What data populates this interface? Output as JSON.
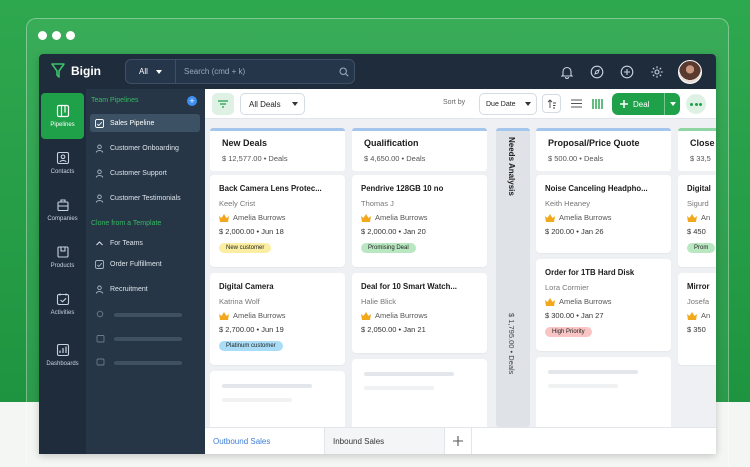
{
  "app": {
    "name": "Bigin"
  },
  "search": {
    "scope": "All",
    "placeholder": "Search (cmd + k)"
  },
  "topbar": {
    "icons": [
      "bell-icon",
      "compass-icon",
      "plus-circle-icon",
      "gear-icon",
      "user-avatar"
    ]
  },
  "leftnav": [
    {
      "label": "Pipelines",
      "icon": "pipelines-icon",
      "active": true
    },
    {
      "label": "Contacts",
      "icon": "contacts-icon"
    },
    {
      "label": "Companies",
      "icon": "companies-icon"
    },
    {
      "label": "Products",
      "icon": "products-icon"
    },
    {
      "label": "Activities",
      "icon": "activities-icon"
    },
    {
      "label": "Dashboards",
      "icon": "dashboards-icon"
    }
  ],
  "sidebar": {
    "team_heading": "Team Pipelines",
    "items": [
      {
        "label": "Sales Pipeline",
        "active": true
      },
      {
        "label": "Customer Onboarding"
      },
      {
        "label": "Customer Support"
      },
      {
        "label": "Customer Testimonials"
      }
    ],
    "template_heading": "Clone from a Template",
    "template_group": "For Teams",
    "templates": [
      {
        "label": "Order Fulfillment"
      },
      {
        "label": "Recruitment"
      }
    ]
  },
  "toolbar": {
    "view": "All Deals",
    "sort_by_label": "Sort by",
    "sort_field": "Due Date",
    "new_deal": "Deal"
  },
  "columns": [
    {
      "title": "New Deals",
      "summary": "$ 12,577.00 • Deals"
    },
    {
      "title": "Qualification",
      "summary": "$ 4,650.00 • Deals"
    },
    {
      "title": "Proposal/Price Quote",
      "summary": "$ 500.00 • Deals"
    },
    {
      "title": "Close",
      "summary": "$ 33,5"
    }
  ],
  "collapsed_column": {
    "title": "Needs Analysis",
    "summary": "$ 1,795.00 • Deals"
  },
  "cards": {
    "new_deals": [
      {
        "title": "Back Camera Lens Protec...",
        "contact": "Keely Crist",
        "owner": "Amelia Burrows",
        "amount": "$ 2,000.00 • Jun 18",
        "tag": "New customer",
        "tag_color": "#fbeea2"
      },
      {
        "title": "Digital Camera",
        "contact": "Katrina Wolf",
        "owner": "Amelia Burrows",
        "amount": "$ 2,700.00 • Jun 19",
        "tag": "Platinum customer",
        "tag_color": "#a9dcf7"
      }
    ],
    "qualification": [
      {
        "title": "Pendrive 128GB 10 no",
        "contact": "Thomas J",
        "owner": "Amelia Burrows",
        "amount": "$ 2,000.00 • Jan 20",
        "tag": "Promising Deal",
        "tag_color": "#b9e7c1"
      },
      {
        "title": "Deal for 10 Smart Watch...",
        "contact": "Halie Blick",
        "owner": "Amelia Burrows",
        "amount": "$ 2,050.00 • Jan 21"
      }
    ],
    "proposal": [
      {
        "title": "Noise Canceling Headpho...",
        "contact": "Keith Heaney",
        "owner": "Amelia Burrows",
        "amount": "$ 200.00 • Jan 26"
      },
      {
        "title": "Order for 1TB Hard Disk",
        "contact": "Lora Cormier",
        "owner": "Amelia Burrows",
        "amount": "$ 300.00 • Jan 27",
        "tag": "High Priority",
        "tag_color": "#f8c4c4"
      }
    ],
    "close": [
      {
        "title": "Digital",
        "contact": "Sigurd",
        "owner": "An",
        "amount": "$ 450",
        "tag": "Prom",
        "tag_color": "#b9e7c1"
      },
      {
        "title": "Mirror",
        "contact": "Josefa",
        "owner": "An",
        "amount": "$ 350"
      }
    ]
  },
  "bottom_tabs": [
    {
      "label": "Outbound Sales",
      "active": true
    },
    {
      "label": "Inbound Sales"
    }
  ],
  "colors": {
    "brand_green": "#1fa149",
    "nav_dark": "#1e2c3c",
    "sidebar": "#263646",
    "accent_blue": "#3d7fd6"
  }
}
